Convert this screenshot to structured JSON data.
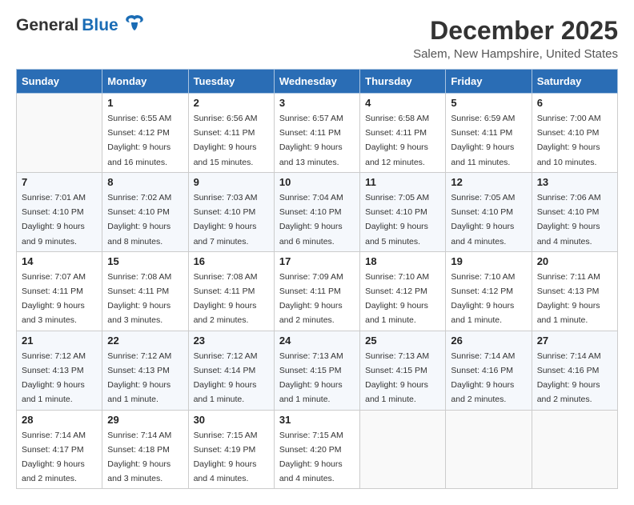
{
  "header": {
    "logo_general": "General",
    "logo_blue": "Blue",
    "month_year": "December 2025",
    "location": "Salem, New Hampshire, United States"
  },
  "days_of_week": [
    "Sunday",
    "Monday",
    "Tuesday",
    "Wednesday",
    "Thursday",
    "Friday",
    "Saturday"
  ],
  "weeks": [
    [
      {
        "day": "",
        "sunrise": "",
        "sunset": "",
        "daylight": ""
      },
      {
        "day": "1",
        "sunrise": "Sunrise: 6:55 AM",
        "sunset": "Sunset: 4:12 PM",
        "daylight": "Daylight: 9 hours and 16 minutes."
      },
      {
        "day": "2",
        "sunrise": "Sunrise: 6:56 AM",
        "sunset": "Sunset: 4:11 PM",
        "daylight": "Daylight: 9 hours and 15 minutes."
      },
      {
        "day": "3",
        "sunrise": "Sunrise: 6:57 AM",
        "sunset": "Sunset: 4:11 PM",
        "daylight": "Daylight: 9 hours and 13 minutes."
      },
      {
        "day": "4",
        "sunrise": "Sunrise: 6:58 AM",
        "sunset": "Sunset: 4:11 PM",
        "daylight": "Daylight: 9 hours and 12 minutes."
      },
      {
        "day": "5",
        "sunrise": "Sunrise: 6:59 AM",
        "sunset": "Sunset: 4:11 PM",
        "daylight": "Daylight: 9 hours and 11 minutes."
      },
      {
        "day": "6",
        "sunrise": "Sunrise: 7:00 AM",
        "sunset": "Sunset: 4:10 PM",
        "daylight": "Daylight: 9 hours and 10 minutes."
      }
    ],
    [
      {
        "day": "7",
        "sunrise": "Sunrise: 7:01 AM",
        "sunset": "Sunset: 4:10 PM",
        "daylight": "Daylight: 9 hours and 9 minutes."
      },
      {
        "day": "8",
        "sunrise": "Sunrise: 7:02 AM",
        "sunset": "Sunset: 4:10 PM",
        "daylight": "Daylight: 9 hours and 8 minutes."
      },
      {
        "day": "9",
        "sunrise": "Sunrise: 7:03 AM",
        "sunset": "Sunset: 4:10 PM",
        "daylight": "Daylight: 9 hours and 7 minutes."
      },
      {
        "day": "10",
        "sunrise": "Sunrise: 7:04 AM",
        "sunset": "Sunset: 4:10 PM",
        "daylight": "Daylight: 9 hours and 6 minutes."
      },
      {
        "day": "11",
        "sunrise": "Sunrise: 7:05 AM",
        "sunset": "Sunset: 4:10 PM",
        "daylight": "Daylight: 9 hours and 5 minutes."
      },
      {
        "day": "12",
        "sunrise": "Sunrise: 7:05 AM",
        "sunset": "Sunset: 4:10 PM",
        "daylight": "Daylight: 9 hours and 4 minutes."
      },
      {
        "day": "13",
        "sunrise": "Sunrise: 7:06 AM",
        "sunset": "Sunset: 4:10 PM",
        "daylight": "Daylight: 9 hours and 4 minutes."
      }
    ],
    [
      {
        "day": "14",
        "sunrise": "Sunrise: 7:07 AM",
        "sunset": "Sunset: 4:11 PM",
        "daylight": "Daylight: 9 hours and 3 minutes."
      },
      {
        "day": "15",
        "sunrise": "Sunrise: 7:08 AM",
        "sunset": "Sunset: 4:11 PM",
        "daylight": "Daylight: 9 hours and 3 minutes."
      },
      {
        "day": "16",
        "sunrise": "Sunrise: 7:08 AM",
        "sunset": "Sunset: 4:11 PM",
        "daylight": "Daylight: 9 hours and 2 minutes."
      },
      {
        "day": "17",
        "sunrise": "Sunrise: 7:09 AM",
        "sunset": "Sunset: 4:11 PM",
        "daylight": "Daylight: 9 hours and 2 minutes."
      },
      {
        "day": "18",
        "sunrise": "Sunrise: 7:10 AM",
        "sunset": "Sunset: 4:12 PM",
        "daylight": "Daylight: 9 hours and 1 minute."
      },
      {
        "day": "19",
        "sunrise": "Sunrise: 7:10 AM",
        "sunset": "Sunset: 4:12 PM",
        "daylight": "Daylight: 9 hours and 1 minute."
      },
      {
        "day": "20",
        "sunrise": "Sunrise: 7:11 AM",
        "sunset": "Sunset: 4:13 PM",
        "daylight": "Daylight: 9 hours and 1 minute."
      }
    ],
    [
      {
        "day": "21",
        "sunrise": "Sunrise: 7:12 AM",
        "sunset": "Sunset: 4:13 PM",
        "daylight": "Daylight: 9 hours and 1 minute."
      },
      {
        "day": "22",
        "sunrise": "Sunrise: 7:12 AM",
        "sunset": "Sunset: 4:13 PM",
        "daylight": "Daylight: 9 hours and 1 minute."
      },
      {
        "day": "23",
        "sunrise": "Sunrise: 7:12 AM",
        "sunset": "Sunset: 4:14 PM",
        "daylight": "Daylight: 9 hours and 1 minute."
      },
      {
        "day": "24",
        "sunrise": "Sunrise: 7:13 AM",
        "sunset": "Sunset: 4:15 PM",
        "daylight": "Daylight: 9 hours and 1 minute."
      },
      {
        "day": "25",
        "sunrise": "Sunrise: 7:13 AM",
        "sunset": "Sunset: 4:15 PM",
        "daylight": "Daylight: 9 hours and 1 minute."
      },
      {
        "day": "26",
        "sunrise": "Sunrise: 7:14 AM",
        "sunset": "Sunset: 4:16 PM",
        "daylight": "Daylight: 9 hours and 2 minutes."
      },
      {
        "day": "27",
        "sunrise": "Sunrise: 7:14 AM",
        "sunset": "Sunset: 4:16 PM",
        "daylight": "Daylight: 9 hours and 2 minutes."
      }
    ],
    [
      {
        "day": "28",
        "sunrise": "Sunrise: 7:14 AM",
        "sunset": "Sunset: 4:17 PM",
        "daylight": "Daylight: 9 hours and 2 minutes."
      },
      {
        "day": "29",
        "sunrise": "Sunrise: 7:14 AM",
        "sunset": "Sunset: 4:18 PM",
        "daylight": "Daylight: 9 hours and 3 minutes."
      },
      {
        "day": "30",
        "sunrise": "Sunrise: 7:15 AM",
        "sunset": "Sunset: 4:19 PM",
        "daylight": "Daylight: 9 hours and 4 minutes."
      },
      {
        "day": "31",
        "sunrise": "Sunrise: 7:15 AM",
        "sunset": "Sunset: 4:20 PM",
        "daylight": "Daylight: 9 hours and 4 minutes."
      },
      {
        "day": "",
        "sunrise": "",
        "sunset": "",
        "daylight": ""
      },
      {
        "day": "",
        "sunrise": "",
        "sunset": "",
        "daylight": ""
      },
      {
        "day": "",
        "sunrise": "",
        "sunset": "",
        "daylight": ""
      }
    ]
  ]
}
